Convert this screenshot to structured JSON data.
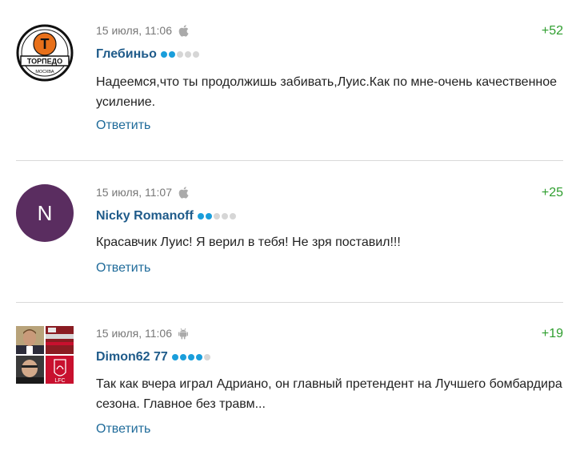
{
  "comments": [
    {
      "time": "15 июля, 11:06",
      "device": "apple-icon",
      "author": "Глебиньо",
      "rating_level": 2,
      "rating_max": 5,
      "score": "+52",
      "text": "Надеемся,что ты продолжишь забивать,Луис.Как по мне-очень качественное усиление.",
      "reply_label": "Ответить",
      "avatar": {
        "type": "club-logo",
        "letter": "Т",
        "name": "ТОРПЕДО",
        "city": "МОСКВА",
        "colors": {
          "primary": "#111111",
          "accent": "#e8701a"
        }
      }
    },
    {
      "time": "15 июля, 11:07",
      "device": "apple-icon",
      "author": "Nicky Romanoff",
      "rating_level": 2,
      "rating_max": 5,
      "score": "+25",
      "text": "Красавчик Луис! Я верил в тебя! Не зря поставил!!!",
      "reply_label": "Ответить",
      "avatar": {
        "type": "initial",
        "letter": "N",
        "colors": {
          "background": "#5a2d60",
          "text": "#ffffff"
        }
      }
    },
    {
      "time": "15 июля, 11:06",
      "device": "android-icon",
      "author": "Dimon62 77",
      "rating_level": 4,
      "rating_max": 5,
      "score": "+19",
      "text": "Так как вчера играл Адриано, он главный претендент на Лучшего бомбардира сезона. Главное без травм...",
      "reply_label": "Ответить",
      "avatar": {
        "type": "photo-collage",
        "text": "LFC",
        "colors": {
          "red": "#c8102e",
          "skin": "#c99a7a"
        }
      }
    }
  ],
  "colors": {
    "author": "#1f5b8a",
    "score": "#2e9e2e",
    "meta": "#777777",
    "reply": "#1f6b9a",
    "rating_on": "#1a9edb",
    "rating_off": "#d6d6d6"
  }
}
